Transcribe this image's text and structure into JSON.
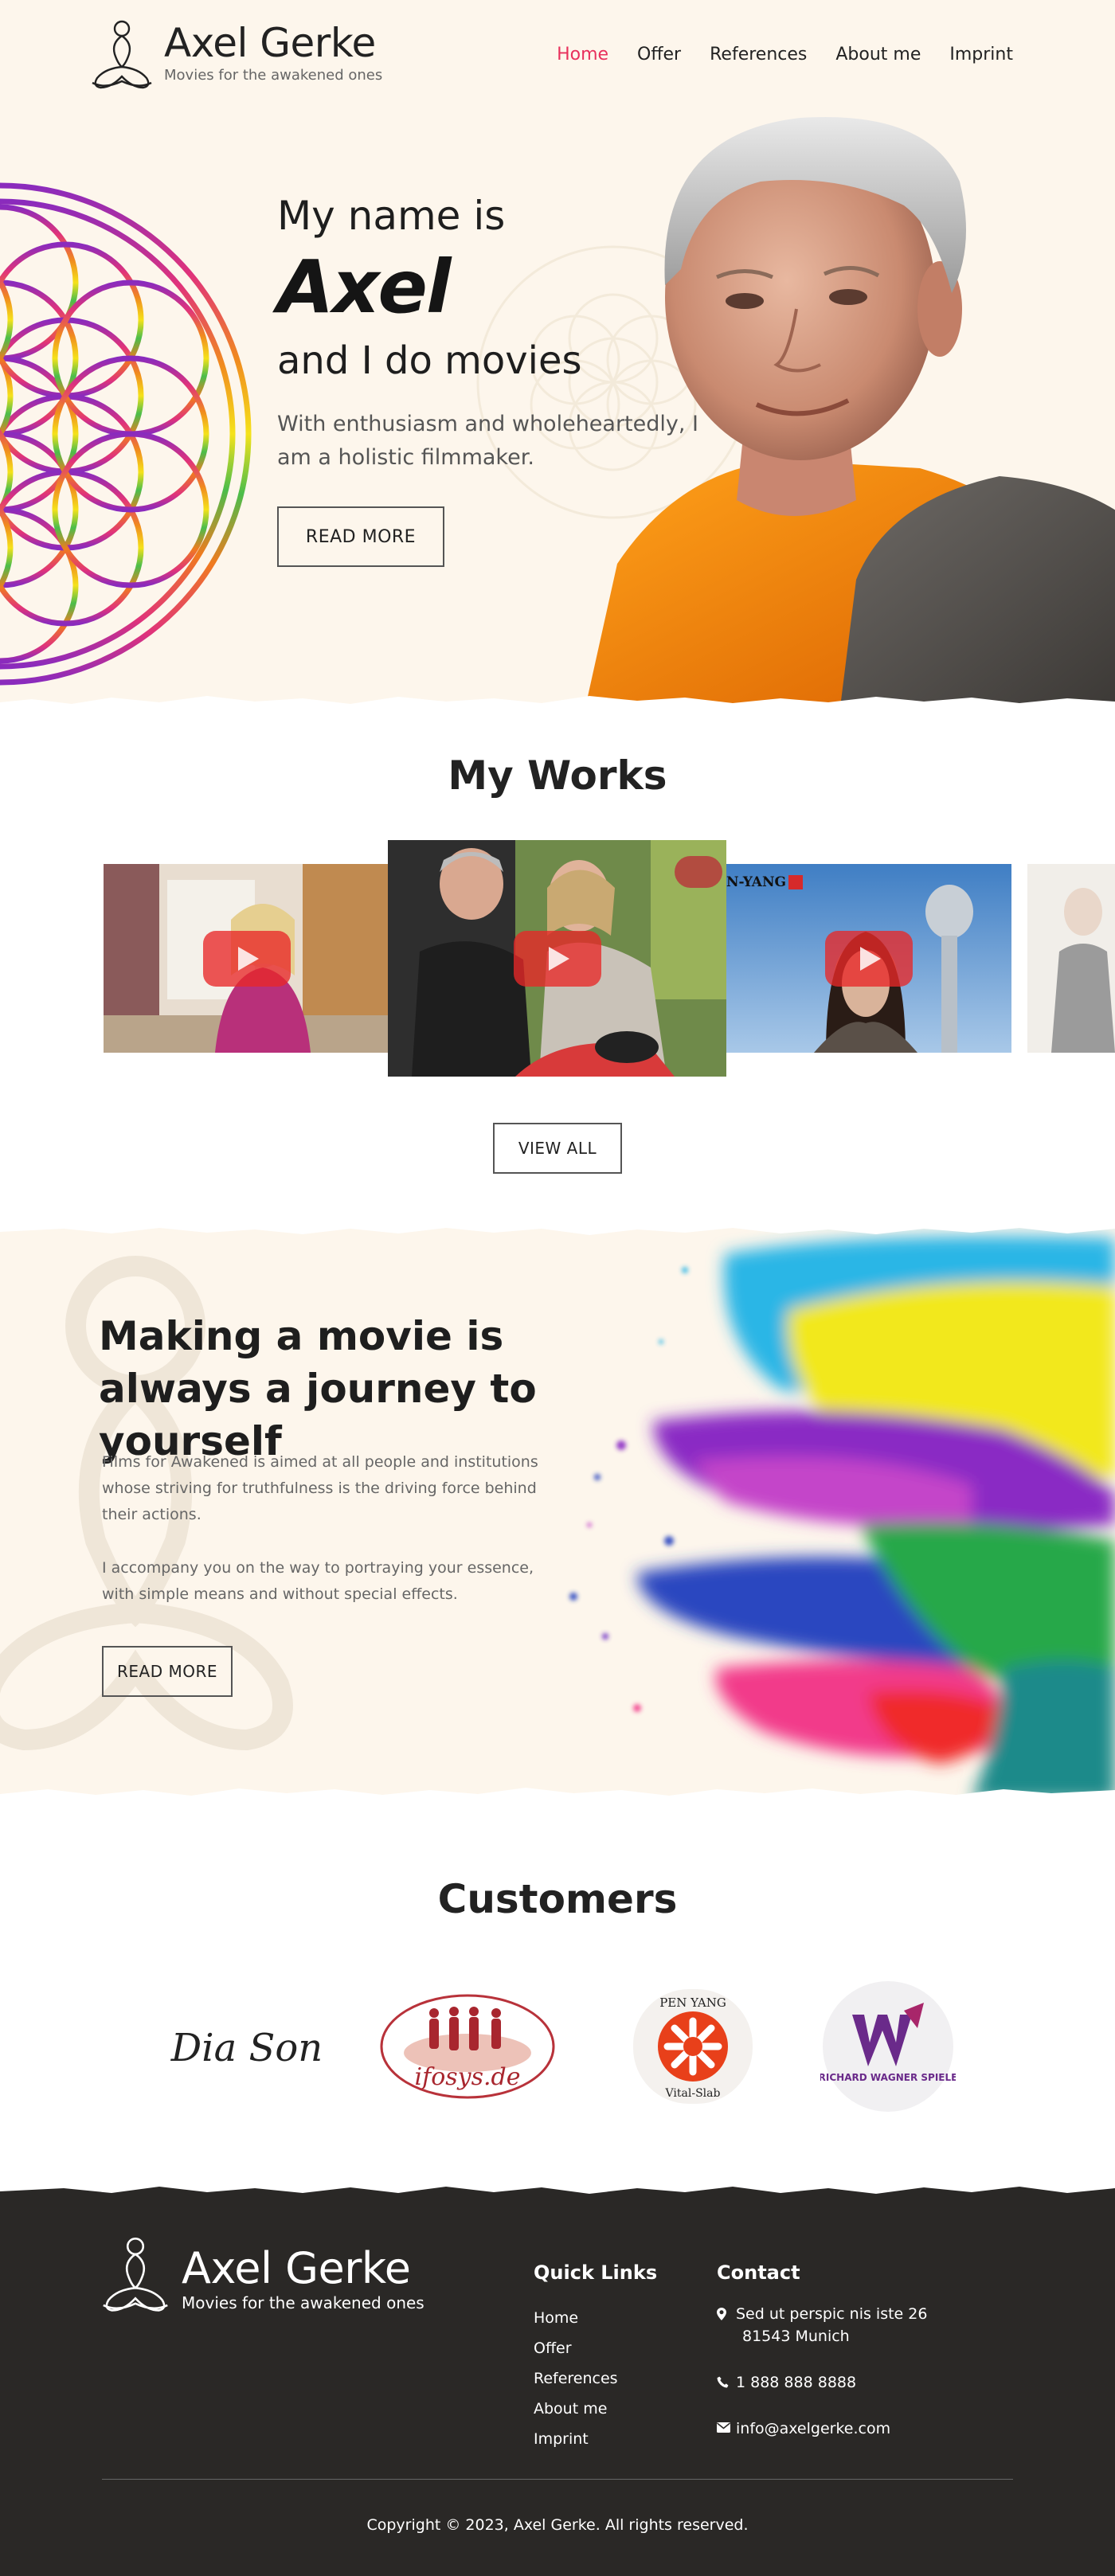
{
  "brand": {
    "name": "Axel Gerke",
    "tagline": "Movies for the awakened ones"
  },
  "nav": {
    "items": [
      {
        "label": "Home",
        "active": true
      },
      {
        "label": "Offer",
        "active": false
      },
      {
        "label": "References",
        "active": false
      },
      {
        "label": "About me",
        "active": false
      },
      {
        "label": "Imprint",
        "active": false
      }
    ],
    "active_color": "#e8305c"
  },
  "hero": {
    "line1": "My name is",
    "name": "Axel",
    "line2": "and I do movies",
    "subtitle": "With enthusiasm and wholeheartedly, I am a holistic filmmaker.",
    "button": "READ MORE"
  },
  "works": {
    "title": "My Works",
    "videos": [
      {
        "icon": "youtube-play-icon"
      },
      {
        "icon": "youtube-play-icon"
      },
      {
        "icon": "youtube-play-icon",
        "overlay_text": "N-YANG"
      },
      {
        "icon": "youtube-play-icon"
      }
    ],
    "button": "VIEW ALL"
  },
  "journey": {
    "title": "Making a movie is always a journey to yourself",
    "paragraph1": "Films for Awakened is aimed at all people and institutions whose striving for truthfulness is the driving force behind their actions.",
    "paragraph2": "I accompany you on the way to portraying your essence, with simple means and without special effects.",
    "button": "READ MORE"
  },
  "customers": {
    "title": "Customers",
    "logos": [
      {
        "name": "Dia Son"
      },
      {
        "name": "ifosys.de"
      },
      {
        "name": "PEN YANG",
        "subtitle": "Vital-Slab"
      },
      {
        "name": "RICHARD WAGNER SPIELE"
      }
    ]
  },
  "footer": {
    "brand_name": "Axel Gerke",
    "brand_tagline": "Movies for the awakened ones",
    "quick_links_title": "Quick Links",
    "quick_links": [
      "Home",
      "Offer",
      "References",
      "About me",
      "Imprint"
    ],
    "contact_title": "Contact",
    "address_line1": "Sed ut perspic nis iste 26",
    "address_line2": "81543 Munich",
    "phone": "1 888 888 8888",
    "email": "info@axelgerke.com",
    "copyright": "Copyright © 2023, Axel Gerke. All rights reserved."
  }
}
